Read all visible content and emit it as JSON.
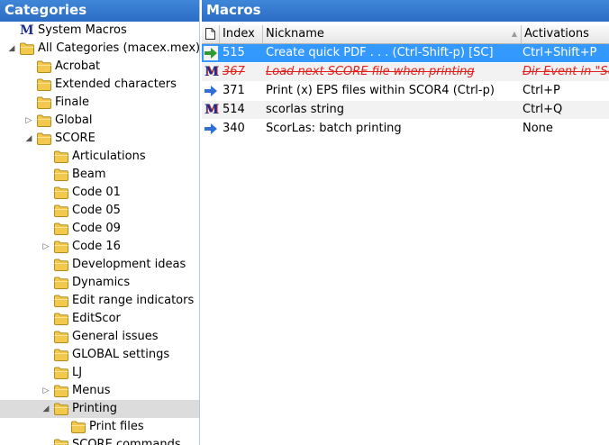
{
  "colors": {
    "header_bg": "#2b6cc4",
    "selected_row_bg": "#3399ff",
    "disabled_text": "#e0201c",
    "folder": "#f2c94c"
  },
  "left_pane": {
    "title": "Categories",
    "tree": [
      {
        "label": "System Macros",
        "icon": "m-logo-icon",
        "expander": ""
      },
      {
        "label": "All Categories (macex.mex)",
        "icon": "folder-icon",
        "expander": "expanded"
      },
      {
        "label": "Acrobat",
        "icon": "folder-icon",
        "expander": ""
      },
      {
        "label": "Extended characters",
        "icon": "folder-icon",
        "expander": ""
      },
      {
        "label": "Finale",
        "icon": "folder-icon",
        "expander": ""
      },
      {
        "label": "Global",
        "icon": "folder-icon",
        "expander": "collapsed"
      },
      {
        "label": "SCORE",
        "icon": "folder-icon",
        "expander": "expanded"
      },
      {
        "label": "Articulations",
        "icon": "folder-icon",
        "expander": ""
      },
      {
        "label": "Beam",
        "icon": "folder-icon",
        "expander": ""
      },
      {
        "label": "Code 01",
        "icon": "folder-icon",
        "expander": ""
      },
      {
        "label": "Code 05",
        "icon": "folder-icon",
        "expander": ""
      },
      {
        "label": "Code 09",
        "icon": "folder-icon",
        "expander": ""
      },
      {
        "label": "Code 16",
        "icon": "folder-icon",
        "expander": "collapsed"
      },
      {
        "label": "Development ideas",
        "icon": "folder-icon",
        "expander": ""
      },
      {
        "label": "Dynamics",
        "icon": "folder-icon",
        "expander": ""
      },
      {
        "label": "Edit range indicators",
        "icon": "folder-icon",
        "expander": ""
      },
      {
        "label": "EditScor",
        "icon": "folder-icon",
        "expander": ""
      },
      {
        "label": "General issues",
        "icon": "folder-icon",
        "expander": ""
      },
      {
        "label": "GLOBAL settings",
        "icon": "folder-icon",
        "expander": ""
      },
      {
        "label": "LJ",
        "icon": "folder-icon",
        "expander": ""
      },
      {
        "label": "Menus",
        "icon": "folder-icon",
        "expander": "collapsed"
      },
      {
        "label": "Printing",
        "icon": "folder-icon",
        "expander": "expanded",
        "selected": true
      },
      {
        "label": "Print files",
        "icon": "folder-icon",
        "expander": ""
      },
      {
        "label": "SCORE commands",
        "icon": "folder-icon",
        "expander": ""
      }
    ]
  },
  "right_pane": {
    "title": "Macros",
    "columns": {
      "index": "Index",
      "nickname": "Nickname",
      "activations": "Activations"
    },
    "rows": [
      {
        "icon": "green-arrow-icon",
        "index": "515",
        "nickname": "Create quick PDF . . . (Ctrl-Shift-p) [SC]",
        "activation": "Ctrl+Shift+P",
        "selected": true
      },
      {
        "icon": "m-logo-icon",
        "index": "367",
        "nickname": "Load next SCORE file when printing",
        "activation": "Dir Event in \"Se",
        "disabled": true
      },
      {
        "icon": "blue-arrow-icon",
        "index": "371",
        "nickname": "Print (x) EPS files within SCOR4 (Ctrl-p)",
        "activation": "Ctrl+P"
      },
      {
        "icon": "m-logo-icon",
        "index": "514",
        "nickname": "scorlas string",
        "activation": "Ctrl+Q"
      },
      {
        "icon": "blue-arrow-icon",
        "index": "340",
        "nickname": "ScorLas: batch printing",
        "activation": "None"
      }
    ]
  }
}
